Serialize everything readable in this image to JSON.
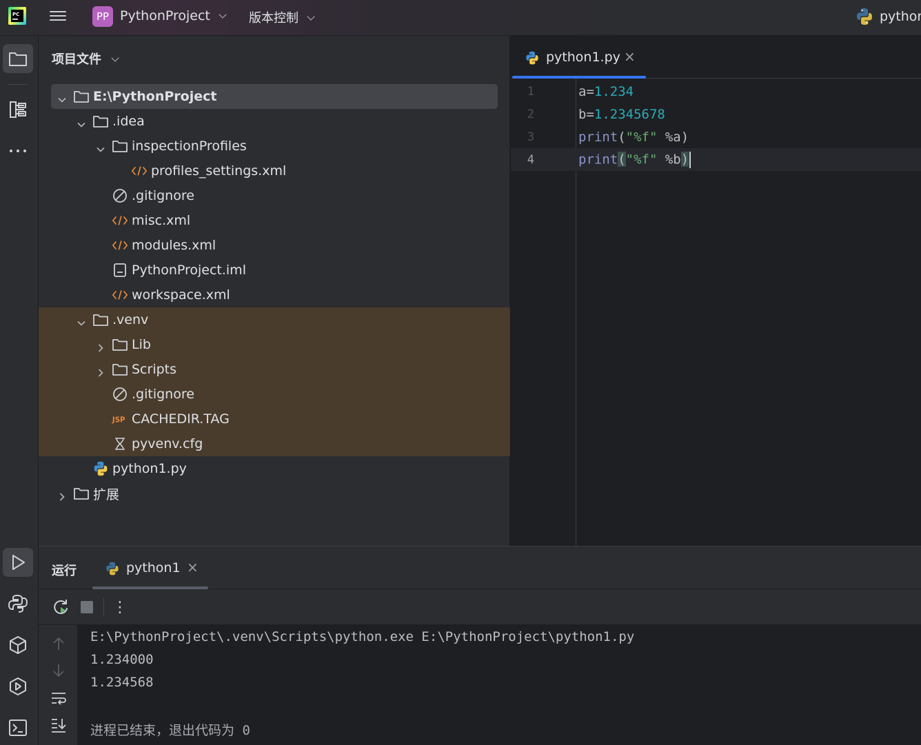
{
  "titlebar": {
    "project_badge": "PP",
    "project_name": "PythonProject",
    "vcs_menu": "版本控制",
    "interpreter": "python"
  },
  "project_panel": {
    "title": "项目文件",
    "tree": [
      {
        "label": "E:\\PythonProject",
        "kind": "folder",
        "expanded": true,
        "selected": true
      },
      {
        "label": ".idea",
        "kind": "folder",
        "expanded": true
      },
      {
        "label": "inspectionProfiles",
        "kind": "folder",
        "expanded": true
      },
      {
        "label": "profiles_settings.xml",
        "kind": "xml-file"
      },
      {
        "label": ".gitignore",
        "kind": "ignore-file"
      },
      {
        "label": "misc.xml",
        "kind": "xml-file"
      },
      {
        "label": "modules.xml",
        "kind": "xml-file"
      },
      {
        "label": "PythonProject.iml",
        "kind": "iml-file"
      },
      {
        "label": "workspace.xml",
        "kind": "xml-file"
      },
      {
        "label": ".venv",
        "kind": "folder",
        "expanded": true,
        "excluded": true
      },
      {
        "label": "Lib",
        "kind": "folder",
        "expanded": false,
        "excluded": true
      },
      {
        "label": "Scripts",
        "kind": "folder",
        "expanded": false,
        "excluded": true
      },
      {
        "label": ".gitignore",
        "kind": "ignore-file",
        "excluded": true
      },
      {
        "label": "CACHEDIR.TAG",
        "kind": "tag-file",
        "excluded": true
      },
      {
        "label": "pyvenv.cfg",
        "kind": "cfg-file",
        "excluded": true
      },
      {
        "label": "python1.py",
        "kind": "python-file"
      },
      {
        "label": "扩展",
        "kind": "folder",
        "expanded": false
      }
    ]
  },
  "editor": {
    "tab_label": "python1.py",
    "close_glyph": "×",
    "line_numbers": [
      "1",
      "2",
      "3",
      "4"
    ],
    "lines": [
      {
        "var": "a",
        "op": "=",
        "num": "1.234"
      },
      {
        "var": "b",
        "op": "=",
        "num": "1.2345678"
      },
      {
        "fn": "print",
        "open": "(",
        "str": "\"%f\"",
        "rest": " %a",
        "close": ")"
      },
      {
        "fn": "print",
        "open": "(",
        "str": "\"%f\"",
        "rest": " %b",
        "close": ")"
      }
    ],
    "current_line": 4
  },
  "run_panel": {
    "title": "运行",
    "tab_label": "python1",
    "close_glyph": "×",
    "more_glyph": "⋮",
    "console": [
      "E:\\PythonProject\\.venv\\Scripts\\python.exe E:\\PythonProject\\python1.py",
      "1.234000",
      "1.234568",
      "",
      "进程已结束，退出代码为 0"
    ]
  },
  "colors": {
    "accent": "#3574f0",
    "number": "#2aacb8",
    "string": "#6aab73",
    "function": "#8b95c9",
    "excluded_bg": "#4a3c2a"
  }
}
